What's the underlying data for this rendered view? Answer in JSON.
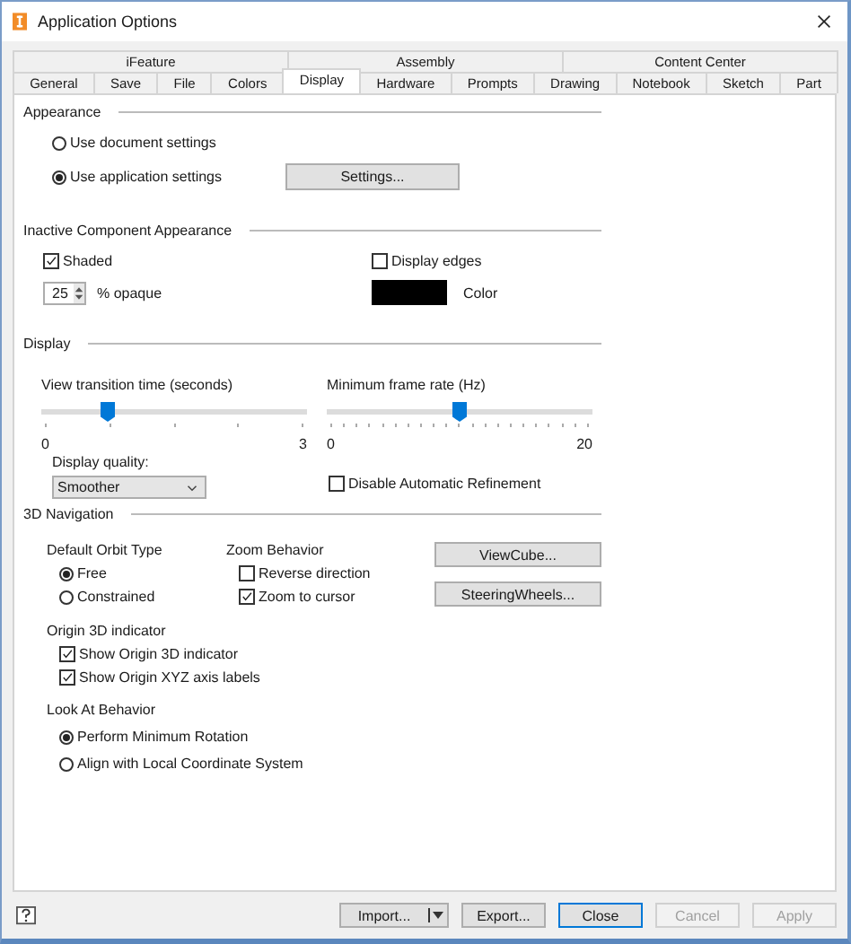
{
  "window": {
    "title": "Application Options"
  },
  "tab_rows": [
    [
      {
        "label": "iFeature",
        "selected": false
      },
      {
        "label": "Assembly",
        "selected": false
      },
      {
        "label": "Content Center",
        "selected": false
      }
    ],
    [
      {
        "label": "General",
        "selected": false
      },
      {
        "label": "Save",
        "selected": false
      },
      {
        "label": "File",
        "selected": false
      },
      {
        "label": "Colors",
        "selected": false
      },
      {
        "label": "Display",
        "selected": true
      },
      {
        "label": "Hardware",
        "selected": false
      },
      {
        "label": "Prompts",
        "selected": false
      },
      {
        "label": "Drawing",
        "selected": false
      },
      {
        "label": "Notebook",
        "selected": false
      },
      {
        "label": "Sketch",
        "selected": false
      },
      {
        "label": "Part",
        "selected": false
      }
    ]
  ],
  "appearance": {
    "heading": "Appearance",
    "options": [
      {
        "label": "Use document settings",
        "selected": false
      },
      {
        "label": "Use application settings",
        "selected": true
      }
    ],
    "settings_button": "Settings..."
  },
  "inactive": {
    "heading": "Inactive Component Appearance",
    "shaded": {
      "label": "Shaded",
      "checked": true
    },
    "display_edges": {
      "label": "Display edges",
      "checked": false
    },
    "opacity": {
      "value": "25",
      "unit": "% opaque"
    },
    "swatch": {
      "label": "Color",
      "color": "#000000"
    }
  },
  "display": {
    "heading": "Display",
    "sliders": [
      {
        "label": "View transition time (seconds)",
        "level": 0.25,
        "min": "0",
        "max": "3"
      },
      {
        "label": "Minimum frame rate (Hz)",
        "level": 0.5,
        "min": "0",
        "max": "20"
      }
    ],
    "quality": {
      "label": "Display quality:",
      "value": "Smoother"
    },
    "refinement": {
      "label": "Disable Automatic Refinement",
      "checked": false
    }
  },
  "navigation": {
    "heading": "3D Navigation",
    "orbit": {
      "heading": "Default Orbit Type",
      "options": [
        {
          "label": "Free",
          "selected": true
        },
        {
          "label": "Constrained",
          "selected": false
        }
      ]
    },
    "zoom": {
      "heading": "Zoom Behavior",
      "options": [
        {
          "label": "Reverse direction",
          "checked": false
        },
        {
          "label": "Zoom to cursor",
          "checked": true
        }
      ]
    },
    "buttons": [
      "ViewCube...",
      "SteeringWheels..."
    ],
    "origin": {
      "heading": "Origin 3D indicator",
      "options": [
        {
          "label": "Show Origin 3D indicator",
          "checked": true
        },
        {
          "label": "Show Origin XYZ axis labels",
          "checked": true
        }
      ]
    },
    "look_at": {
      "heading": "Look At Behavior",
      "options": [
        {
          "label": "Perform Minimum Rotation",
          "selected": true
        },
        {
          "label": "Align with Local Coordinate System",
          "selected": false
        }
      ]
    }
  },
  "footer": {
    "buttons": [
      {
        "label": "Import...",
        "kind": "split",
        "disabled": false
      },
      {
        "label": "Export...",
        "kind": "plain",
        "disabled": false
      },
      {
        "label": "Close",
        "kind": "default",
        "disabled": false
      },
      {
        "label": "Cancel",
        "kind": "plain",
        "disabled": true
      },
      {
        "label": "Apply",
        "kind": "plain",
        "disabled": true
      }
    ]
  }
}
